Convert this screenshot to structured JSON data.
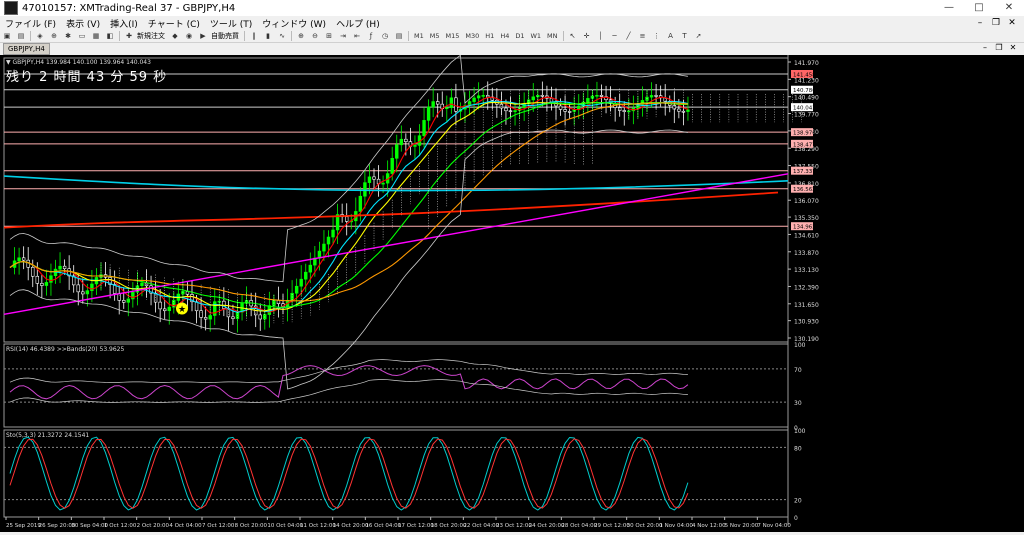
{
  "window": {
    "title": "47010157: XMTrading-Real 37 - GBPJPY,H4",
    "controls": [
      "—",
      "□",
      "✕"
    ]
  },
  "menu": [
    "ファイル (F)",
    "表示 (V)",
    "挿入(I)",
    "チャート (C)",
    "ツール (T)",
    "ウィンドウ (W)",
    "ヘルプ (H)"
  ],
  "toolbar": {
    "new_order": "新規注文",
    "auto_trade": "自動売買",
    "timeframes": [
      "M1",
      "M5",
      "M15",
      "M30",
      "H1",
      "H4",
      "D1",
      "W1",
      "MN"
    ]
  },
  "doc_tab": "GBPJPY,H4",
  "chart": {
    "info_line": "▼ GBPJPY,H4  139.984 140.100 139.964 140.043",
    "countdown": "残り 2 時間 43 分 59 秒",
    "price_ticks": [
      "141.970",
      "141.230",
      "140.490",
      "139.770",
      "139.030",
      "138.290",
      "137.550",
      "136.810",
      "136.070",
      "135.350",
      "134.610",
      "133.870",
      "133.130",
      "132.390",
      "131.650",
      "130.930",
      "130.190"
    ],
    "highlight_prices": [
      {
        "label": "141.458",
        "color": "#ff6666"
      },
      {
        "label": "140.786",
        "color": "#ffffff"
      },
      {
        "label": "140.043",
        "color": "#ffffff"
      },
      {
        "label": "138.976",
        "color": "#ffb0b0"
      },
      {
        "label": "138.477",
        "color": "#ffb0b0"
      },
      {
        "label": "137.331",
        "color": "#ffb0b0"
      },
      {
        "label": "136.562",
        "color": "#ffb0b0"
      },
      {
        "label": "134.962",
        "color": "#ffb0b0"
      }
    ]
  },
  "rsi": {
    "label": "RSI(14) 46.4389  >>Bands(20) 53.9625",
    "ticks": [
      "100",
      "70",
      "30",
      "0"
    ]
  },
  "stoch": {
    "label": "Sto(5,3,3) 21.3272 24.1541",
    "ticks": [
      "100",
      "80",
      "20",
      "0"
    ]
  },
  "time_axis": [
    "25 Sep 2019",
    "26 Sep 20:00",
    "30 Sep 04:00",
    "1 Oct 12:00",
    "2 Oct 20:00",
    "4 Oct 04:00",
    "7 Oct 12:00",
    "8 Oct 20:00",
    "10 Oct 04:00",
    "11 Oct 12:00",
    "14 Oct 20:00",
    "16 Oct 04:00",
    "17 Oct 12:00",
    "18 Oct 20:00",
    "22 Oct 04:00",
    "23 Oct 12:00",
    "24 Oct 20:00",
    "28 Oct 04:00",
    "29 Oct 12:00",
    "30 Oct 20:00",
    "1 Nov 04:00",
    "4 Nov 12:00",
    "5 Nov 20:00",
    "7 Nov 04:00"
  ],
  "colors": {
    "bull": "#00ff00",
    "bear": "#ffffff",
    "ma_fast": "#ff0000",
    "ma_cyan": "#00e5ff",
    "ma_yellow": "#ffff00",
    "ma_green": "#00ff00",
    "ma_orange": "#ff9900",
    "ma_magenta": "#ff00ff",
    "ma_red_long": "#ff2200",
    "ma_cyan_long": "#00cfe8",
    "rsi": "#cc44cc",
    "stoch_main": "#00cccc",
    "stoch_signal": "#ff3333"
  }
}
